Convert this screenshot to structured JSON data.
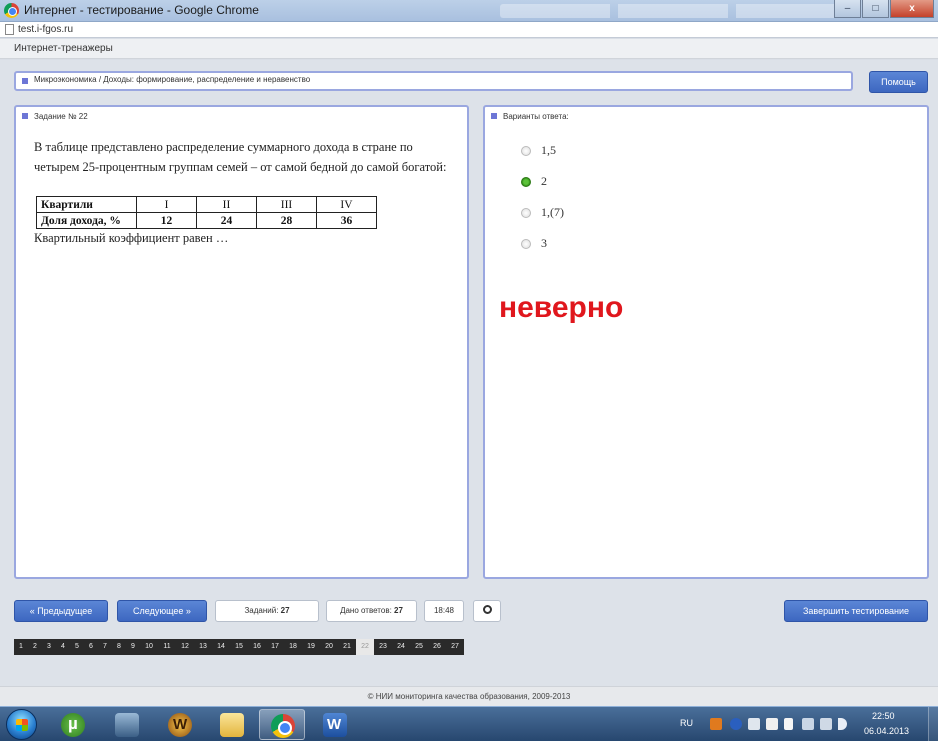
{
  "browser": {
    "window_title": "Интернет - тестирование - Google Chrome",
    "url": "test.i-fgos.ru",
    "buttons": {
      "minimize": "–",
      "maximize": "□",
      "close": "x"
    }
  },
  "site": {
    "header_title": "Интернет-тренажеры"
  },
  "breadcrumb": "Микроэкономика / Доходы: формирование, распределение и неравенство",
  "help_button": "Помощь",
  "question": {
    "header": "Задание № 22",
    "text": "В таблице представлено распределение суммарного дохода в стране по четырем 25-процентным группам семей – от самой бедной до самой богатой:",
    "table": {
      "header_label": "Квартили",
      "headers": [
        "I",
        "II",
        "III",
        "IV"
      ],
      "row_label": "Доля дохода, %",
      "values": [
        "12",
        "24",
        "28",
        "36"
      ]
    },
    "tail": "Квартильный коэффициент равен …"
  },
  "answers": {
    "header": "Варианты ответа:",
    "options": [
      {
        "label": "1,5",
        "selected": false
      },
      {
        "label": "2",
        "selected": true
      },
      {
        "label": "1,(7)",
        "selected": false
      },
      {
        "label": "3",
        "selected": false
      }
    ],
    "verdict": "неверно",
    "verdict_color": "#e0171d"
  },
  "controls": {
    "prev": "« Предыдущее",
    "next": "Следующее »",
    "tasks_label": "Заданий:",
    "tasks_value": "27",
    "answered_label": "Дано ответов:",
    "answered_value": "27",
    "timer": "18:48",
    "finish": "Завершить тестирование"
  },
  "question_nav": {
    "numbers": [
      "1",
      "2",
      "3",
      "4",
      "5",
      "6",
      "7",
      "8",
      "9",
      "10",
      "11",
      "12",
      "13",
      "14",
      "15",
      "16",
      "17",
      "18",
      "19",
      "20",
      "21",
      "22",
      "23",
      "24",
      "25",
      "26",
      "27"
    ],
    "current": "22"
  },
  "footer": "© НИИ мониторинга качества образования, 2009-2013",
  "taskbar": {
    "apps": [
      "utorrent-icon",
      "game-icon",
      "wow-icon",
      "folder-icon",
      "chrome-icon",
      "word-icon"
    ],
    "active_app": "chrome-icon",
    "language": "RU",
    "time": "22:50",
    "date": "06.04.2013"
  },
  "colors": {
    "accent": "#3d67c0",
    "panel_border": "#9aa7e0",
    "selected_radio": "#3fa51f"
  }
}
